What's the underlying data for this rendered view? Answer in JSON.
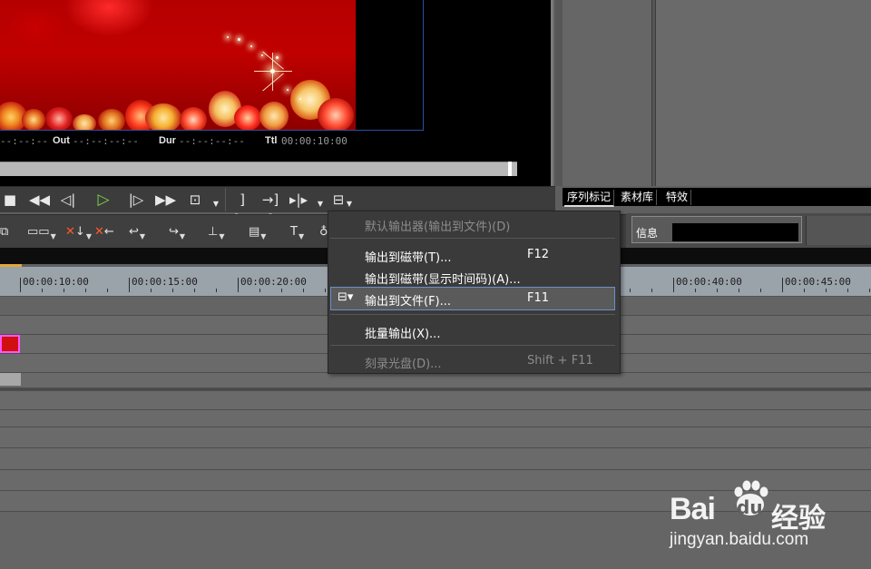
{
  "player": {
    "timecodes": {
      "in_value": "--:--:--",
      "out_label": "Out",
      "out_value": "--:--:--:--",
      "dur_label": "Dur",
      "dur_value": "--:--:--:--",
      "ttl_label": "Ttl",
      "ttl_value": "00:00:10:00"
    },
    "scrub_progress": 0.99
  },
  "right_panel": {
    "tabs": [
      "序列标记",
      "素材库",
      "特效"
    ],
    "info_label": "信息"
  },
  "ruler": {
    "ticks": [
      "00:00:10:00",
      "00:00:15:00",
      "00:00:20:00",
      "00:00:40:00",
      "00:00:45:00"
    ]
  },
  "context_menu": {
    "items": [
      {
        "label": "默认输出器(输出到文件)(D)",
        "shortcut": "",
        "enabled": false
      },
      {
        "label": "输出到磁带(T)...",
        "shortcut": "F12",
        "enabled": true
      },
      {
        "label": "输出到磁带(显示时间码)(A)...",
        "shortcut": "",
        "enabled": true
      },
      {
        "label": "输出到文件(F)...",
        "shortcut": "F11",
        "enabled": true,
        "highlighted": true
      },
      {
        "label": "批量输出(X)...",
        "shortcut": "",
        "enabled": true
      },
      {
        "label": "刻录光盘(D)...",
        "shortcut": "Shift + F11",
        "enabled": false
      }
    ]
  },
  "watermark": {
    "brand_bai": "Bai",
    "brand_du": "du",
    "brand_suffix": "经验",
    "url": "jingyan.baidu.com"
  },
  "icons": {
    "play": "play-icon",
    "stop": "stop-icon",
    "rewind": "rewind-icon",
    "fast_forward": "fast-forward-icon",
    "export": "export-icon"
  },
  "colors": {
    "play_green": "#7cd64a",
    "menu_highlight_border": "#6e8fc7",
    "clip_border": "#ff55ff"
  }
}
